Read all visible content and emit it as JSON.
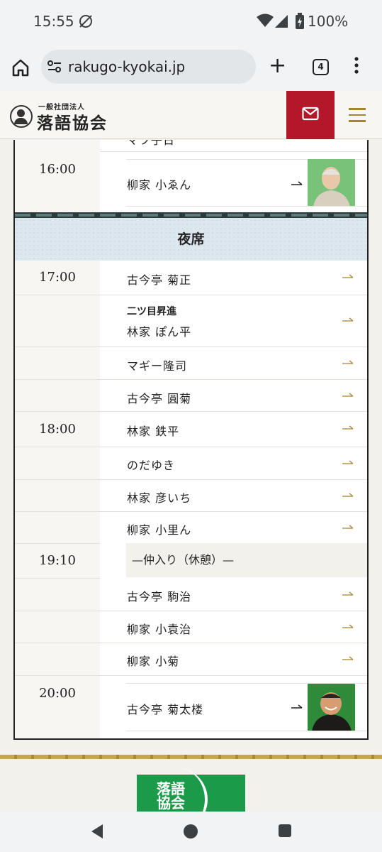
{
  "status": {
    "time": "15:55",
    "battery": "100%"
  },
  "browser": {
    "url": "rakugo-kyokai.jp",
    "tab_count": "4"
  },
  "site": {
    "logo_sub": "一般社団法人",
    "logo_main": "落語協会",
    "footer_logo": "落語協会"
  },
  "schedule": {
    "prev_top_partial": "マツ子日",
    "prev_time": "16:00",
    "prev_last": "柳家 小ゑん",
    "section_title": "夜席",
    "rows": [
      {
        "time": "17:00",
        "name": "古今亭 菊正"
      },
      {
        "time": "",
        "tag": "二ツ目昇進",
        "name": "林家 ぽん平"
      },
      {
        "time": "",
        "name": "マギー隆司"
      },
      {
        "time": "",
        "name": "古今亭 圓菊"
      },
      {
        "time": "18:00",
        "name": "林家 鉄平"
      },
      {
        "time": "",
        "name": "のだゆき"
      },
      {
        "time": "",
        "name": "林家 彦いち"
      },
      {
        "time": "",
        "name": "柳家 小里ん"
      },
      {
        "time": "19:10",
        "name": "—仲入り（休憩）—"
      },
      {
        "time": "",
        "name": "古今亭 駒治"
      },
      {
        "time": "",
        "name": "柳家 小袁治"
      },
      {
        "time": "",
        "name": "柳家 小菊"
      },
      {
        "time": "20:00",
        "name": "古今亭 菊太楼"
      }
    ]
  },
  "colors": {
    "accent_red": "#b3182a",
    "gold": "#a3852e",
    "section_bg": "#dde8ee"
  }
}
